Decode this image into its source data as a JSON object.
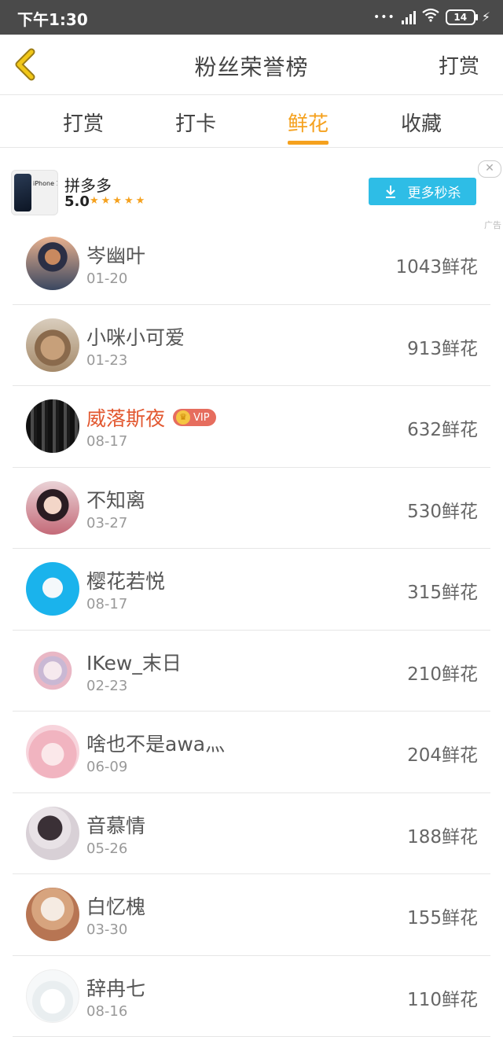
{
  "statusbar": {
    "time": "下午1:30",
    "battery": "14",
    "icons": [
      "more-dots-icon",
      "signal-icon",
      "wifi-icon",
      "battery-icon",
      "charging-icon"
    ]
  },
  "header": {
    "title": "粉丝荣誉榜",
    "right_action": "打赏"
  },
  "tabs": [
    {
      "label": "打赏",
      "active": false
    },
    {
      "label": "打卡",
      "active": false
    },
    {
      "label": "鲜花",
      "active": true
    },
    {
      "label": "收藏",
      "active": false
    }
  ],
  "ad": {
    "thumb_text": "iPhone 12",
    "brand": "拼多多",
    "rating": "5.0",
    "cta": "更多秒杀",
    "close": "✕",
    "label": "广告"
  },
  "fans": [
    {
      "name": "岑幽叶",
      "date": "01-20",
      "count": "1043鲜花",
      "vip": false
    },
    {
      "name": "小咪小可爱",
      "date": "01-23",
      "count": "913鲜花",
      "vip": false
    },
    {
      "name": "威落斯夜",
      "date": "08-17",
      "count": "632鲜花",
      "vip": true,
      "vip_label": "VIP"
    },
    {
      "name": "不知离",
      "date": "03-27",
      "count": "530鲜花",
      "vip": false
    },
    {
      "name": "樱花若悦",
      "date": "08-17",
      "count": "315鲜花",
      "vip": false
    },
    {
      "name": "IKew_末日",
      "date": "02-23",
      "count": "210鲜花",
      "vip": false
    },
    {
      "name": "啥也不是awa灬",
      "date": "06-09",
      "count": "204鲜花",
      "vip": false
    },
    {
      "name": "音慕情",
      "date": "05-26",
      "count": "188鲜花",
      "vip": false
    },
    {
      "name": "白忆槐",
      "date": "03-30",
      "count": "155鲜花",
      "vip": false
    },
    {
      "name": "辞冉七",
      "date": "08-16",
      "count": "110鲜花",
      "vip": false
    }
  ],
  "colors": {
    "accent": "#f5a11e",
    "vip_name": "#e2572f",
    "ad_button": "#2ebde6",
    "statusbar": "#4a4a4a"
  }
}
